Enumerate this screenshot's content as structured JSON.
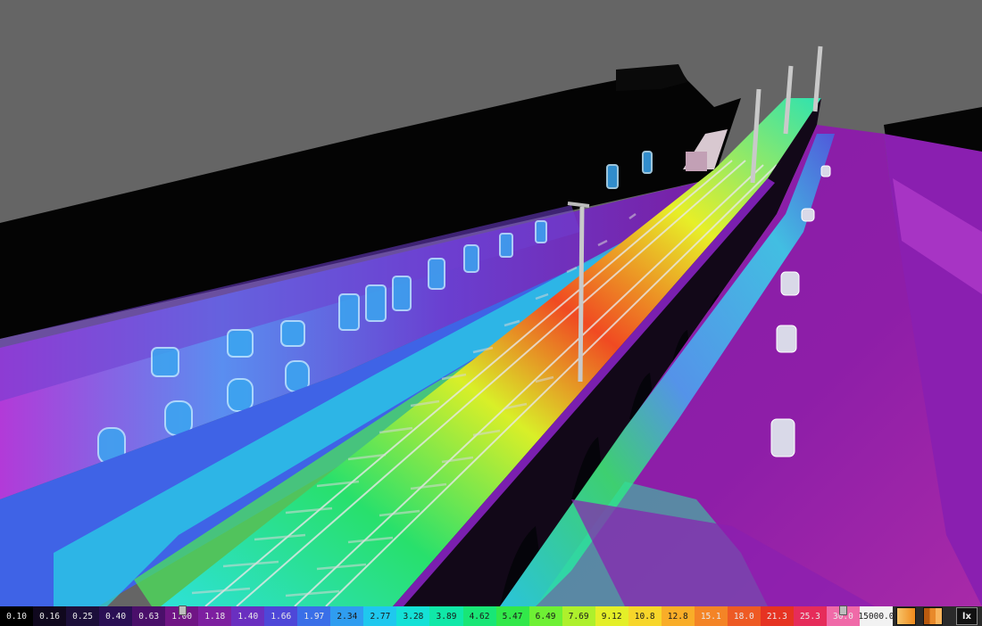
{
  "viewport": {
    "scene": "3D illuminance false-color rendering of railway viaduct and street"
  },
  "legend": {
    "unit": "lx",
    "values": [
      "0.10",
      "0.16",
      "0.25",
      "0.40",
      "0.63",
      "1.00",
      "1.18",
      "1.40",
      "1.66",
      "1.97",
      "2.34",
      "2.77",
      "3.28",
      "3.89",
      "4.62",
      "5.47",
      "6.49",
      "7.69",
      "9.12",
      "10.8",
      "12.8",
      "15.1",
      "18.0",
      "21.3",
      "25.3",
      "30.0",
      "15000.0"
    ],
    "colors": [
      "#000000",
      "#10081e",
      "#1c0f3a",
      "#2a0f54",
      "#4a0f6a",
      "#701585",
      "#7d1fa0",
      "#6a2fc0",
      "#4e47d8",
      "#3a6fe8",
      "#2f9df0",
      "#1fc8ee",
      "#14e1d6",
      "#10e8a8",
      "#18e676",
      "#32e84a",
      "#6ef034",
      "#aef02c",
      "#e4ef28",
      "#f7d62a",
      "#f9ad28",
      "#f48426",
      "#ee5a24",
      "#e63322",
      "#e62c5a",
      "#f06aa8",
      "#f2f2f2"
    ],
    "lower_handle_value": "1.00",
    "upper_handle_value": "30.0"
  },
  "toolbar": {
    "unit_button_label": "lx",
    "gradient_icon": "gradient-swatch-icon",
    "bands_icon": "bands-swatch-icon"
  }
}
